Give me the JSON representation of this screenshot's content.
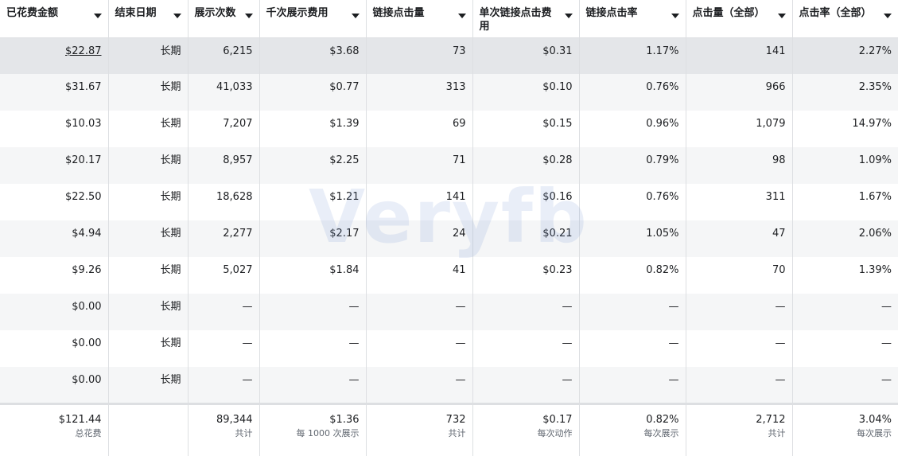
{
  "watermark": "Veryfb",
  "columns": [
    {
      "key": "spend",
      "label": "已花费金额"
    },
    {
      "key": "end",
      "label": "结束日期"
    },
    {
      "key": "impressions",
      "label": "展示次数"
    },
    {
      "key": "cpm",
      "label": "千次展示费用"
    },
    {
      "key": "link_clicks",
      "label": "链接点击量"
    },
    {
      "key": "cpc",
      "label": "单次链接点击费用"
    },
    {
      "key": "ctr",
      "label": "链接点击率"
    },
    {
      "key": "clicks_all",
      "label": "点击量（全部）"
    },
    {
      "key": "ctr_all",
      "label": "点击率（全部）"
    }
  ],
  "rows": [
    [
      "$22.87",
      "长期",
      "6,215",
      "$3.68",
      "73",
      "$0.31",
      "1.17%",
      "141",
      "2.27%"
    ],
    [
      "$31.67",
      "长期",
      "41,033",
      "$0.77",
      "313",
      "$0.10",
      "0.76%",
      "966",
      "2.35%"
    ],
    [
      "$10.03",
      "长期",
      "7,207",
      "$1.39",
      "69",
      "$0.15",
      "0.96%",
      "1,079",
      "14.97%"
    ],
    [
      "$20.17",
      "长期",
      "8,957",
      "$2.25",
      "71",
      "$0.28",
      "0.79%",
      "98",
      "1.09%"
    ],
    [
      "$22.50",
      "长期",
      "18,628",
      "$1.21",
      "141",
      "$0.16",
      "0.76%",
      "311",
      "1.67%"
    ],
    [
      "$4.94",
      "长期",
      "2,277",
      "$2.17",
      "24",
      "$0.21",
      "1.05%",
      "47",
      "2.06%"
    ],
    [
      "$9.26",
      "长期",
      "5,027",
      "$1.84",
      "41",
      "$0.23",
      "0.82%",
      "70",
      "1.39%"
    ],
    [
      "$0.00",
      "长期",
      "—",
      "—",
      "—",
      "—",
      "—",
      "—",
      "—"
    ],
    [
      "$0.00",
      "长期",
      "—",
      "—",
      "—",
      "—",
      "—",
      "—",
      "—"
    ],
    [
      "$0.00",
      "长期",
      "—",
      "—",
      "—",
      "—",
      "—",
      "—",
      "—"
    ]
  ],
  "totals": [
    {
      "value": "$121.44",
      "sub": "总花费"
    },
    {
      "value": "",
      "sub": ""
    },
    {
      "value": "89,344",
      "sub": "共计"
    },
    {
      "value": "$1.36",
      "sub": "每 1000 次展示"
    },
    {
      "value": "732",
      "sub": "共计"
    },
    {
      "value": "$0.17",
      "sub": "每次动作"
    },
    {
      "value": "0.82%",
      "sub": "每次展示"
    },
    {
      "value": "2,712",
      "sub": "共计"
    },
    {
      "value": "3.04%",
      "sub": "每次展示"
    }
  ]
}
